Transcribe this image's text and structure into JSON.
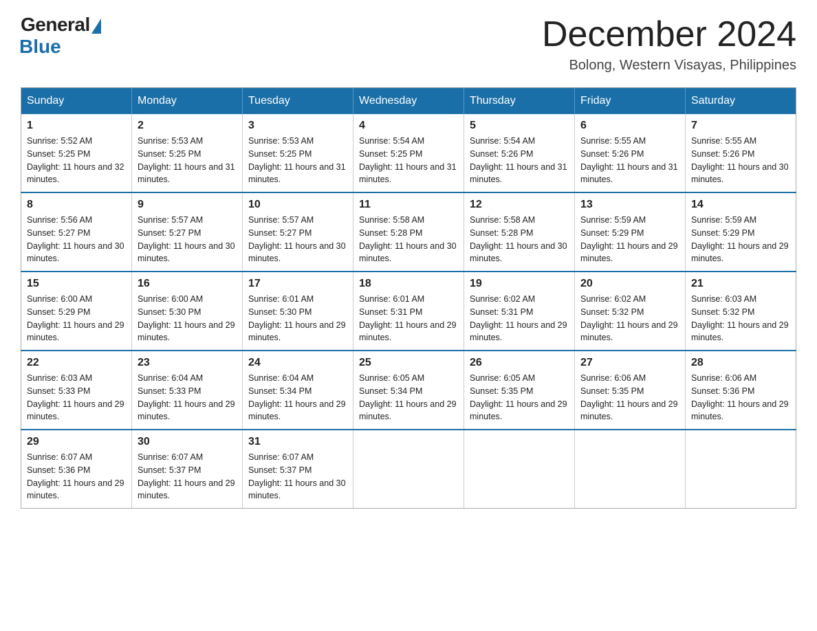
{
  "header": {
    "logo_general": "General",
    "logo_blue": "Blue",
    "month_title": "December 2024",
    "location": "Bolong, Western Visayas, Philippines"
  },
  "days_of_week": [
    "Sunday",
    "Monday",
    "Tuesday",
    "Wednesday",
    "Thursday",
    "Friday",
    "Saturday"
  ],
  "weeks": [
    [
      {
        "day": "1",
        "sunrise": "5:52 AM",
        "sunset": "5:25 PM",
        "daylight": "11 hours and 32 minutes."
      },
      {
        "day": "2",
        "sunrise": "5:53 AM",
        "sunset": "5:25 PM",
        "daylight": "11 hours and 31 minutes."
      },
      {
        "day": "3",
        "sunrise": "5:53 AM",
        "sunset": "5:25 PM",
        "daylight": "11 hours and 31 minutes."
      },
      {
        "day": "4",
        "sunrise": "5:54 AM",
        "sunset": "5:25 PM",
        "daylight": "11 hours and 31 minutes."
      },
      {
        "day": "5",
        "sunrise": "5:54 AM",
        "sunset": "5:26 PM",
        "daylight": "11 hours and 31 minutes."
      },
      {
        "day": "6",
        "sunrise": "5:55 AM",
        "sunset": "5:26 PM",
        "daylight": "11 hours and 31 minutes."
      },
      {
        "day": "7",
        "sunrise": "5:55 AM",
        "sunset": "5:26 PM",
        "daylight": "11 hours and 30 minutes."
      }
    ],
    [
      {
        "day": "8",
        "sunrise": "5:56 AM",
        "sunset": "5:27 PM",
        "daylight": "11 hours and 30 minutes."
      },
      {
        "day": "9",
        "sunrise": "5:57 AM",
        "sunset": "5:27 PM",
        "daylight": "11 hours and 30 minutes."
      },
      {
        "day": "10",
        "sunrise": "5:57 AM",
        "sunset": "5:27 PM",
        "daylight": "11 hours and 30 minutes."
      },
      {
        "day": "11",
        "sunrise": "5:58 AM",
        "sunset": "5:28 PM",
        "daylight": "11 hours and 30 minutes."
      },
      {
        "day": "12",
        "sunrise": "5:58 AM",
        "sunset": "5:28 PM",
        "daylight": "11 hours and 30 minutes."
      },
      {
        "day": "13",
        "sunrise": "5:59 AM",
        "sunset": "5:29 PM",
        "daylight": "11 hours and 29 minutes."
      },
      {
        "day": "14",
        "sunrise": "5:59 AM",
        "sunset": "5:29 PM",
        "daylight": "11 hours and 29 minutes."
      }
    ],
    [
      {
        "day": "15",
        "sunrise": "6:00 AM",
        "sunset": "5:29 PM",
        "daylight": "11 hours and 29 minutes."
      },
      {
        "day": "16",
        "sunrise": "6:00 AM",
        "sunset": "5:30 PM",
        "daylight": "11 hours and 29 minutes."
      },
      {
        "day": "17",
        "sunrise": "6:01 AM",
        "sunset": "5:30 PM",
        "daylight": "11 hours and 29 minutes."
      },
      {
        "day": "18",
        "sunrise": "6:01 AM",
        "sunset": "5:31 PM",
        "daylight": "11 hours and 29 minutes."
      },
      {
        "day": "19",
        "sunrise": "6:02 AM",
        "sunset": "5:31 PM",
        "daylight": "11 hours and 29 minutes."
      },
      {
        "day": "20",
        "sunrise": "6:02 AM",
        "sunset": "5:32 PM",
        "daylight": "11 hours and 29 minutes."
      },
      {
        "day": "21",
        "sunrise": "6:03 AM",
        "sunset": "5:32 PM",
        "daylight": "11 hours and 29 minutes."
      }
    ],
    [
      {
        "day": "22",
        "sunrise": "6:03 AM",
        "sunset": "5:33 PM",
        "daylight": "11 hours and 29 minutes."
      },
      {
        "day": "23",
        "sunrise": "6:04 AM",
        "sunset": "5:33 PM",
        "daylight": "11 hours and 29 minutes."
      },
      {
        "day": "24",
        "sunrise": "6:04 AM",
        "sunset": "5:34 PM",
        "daylight": "11 hours and 29 minutes."
      },
      {
        "day": "25",
        "sunrise": "6:05 AM",
        "sunset": "5:34 PM",
        "daylight": "11 hours and 29 minutes."
      },
      {
        "day": "26",
        "sunrise": "6:05 AM",
        "sunset": "5:35 PM",
        "daylight": "11 hours and 29 minutes."
      },
      {
        "day": "27",
        "sunrise": "6:06 AM",
        "sunset": "5:35 PM",
        "daylight": "11 hours and 29 minutes."
      },
      {
        "day": "28",
        "sunrise": "6:06 AM",
        "sunset": "5:36 PM",
        "daylight": "11 hours and 29 minutes."
      }
    ],
    [
      {
        "day": "29",
        "sunrise": "6:07 AM",
        "sunset": "5:36 PM",
        "daylight": "11 hours and 29 minutes."
      },
      {
        "day": "30",
        "sunrise": "6:07 AM",
        "sunset": "5:37 PM",
        "daylight": "11 hours and 29 minutes."
      },
      {
        "day": "31",
        "sunrise": "6:07 AM",
        "sunset": "5:37 PM",
        "daylight": "11 hours and 30 minutes."
      },
      null,
      null,
      null,
      null
    ]
  ]
}
